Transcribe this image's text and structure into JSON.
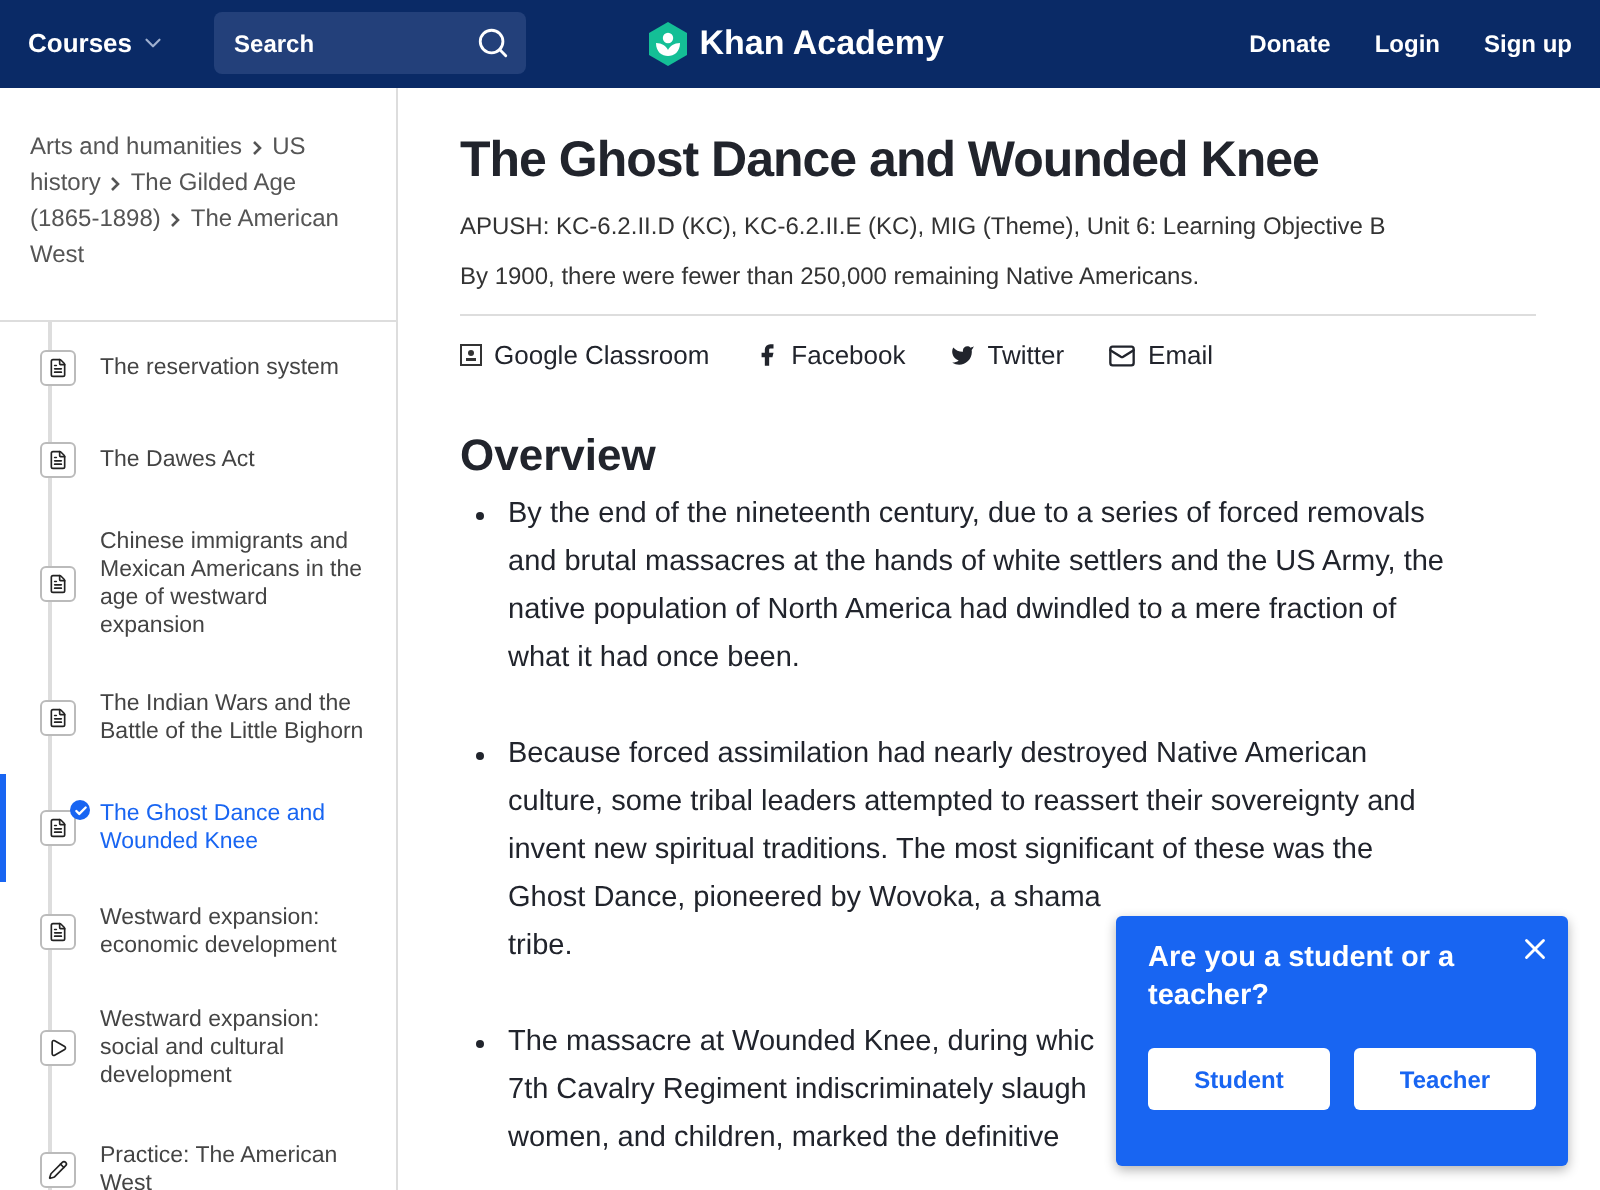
{
  "header": {
    "courses": "Courses",
    "search": {
      "placeholder": "Search"
    },
    "logo": "Khan Academy",
    "links": [
      "Donate",
      "Login",
      "Sign up"
    ]
  },
  "breadcrumb": [
    {
      "parts": [
        "Arts and humanities"
      ]
    },
    {
      "parts": [
        "US",
        "history"
      ]
    },
    {
      "parts": [
        "The Gilded Age",
        "(1865-1898)"
      ]
    },
    {
      "parts": [
        "The American",
        "West"
      ]
    }
  ],
  "sidebar": {
    "items": [
      {
        "kind": "article",
        "label": "The reservation system",
        "selected": false
      },
      {
        "kind": "article",
        "label": "The Dawes Act",
        "selected": false
      },
      {
        "kind": "article",
        "label": "Chinese immigrants and Mexican Americans in the age of westward expansion",
        "selected": false
      },
      {
        "kind": "article",
        "label": "The Indian Wars and the Battle of the Little Bighorn",
        "selected": false
      },
      {
        "kind": "article",
        "label": "The Ghost Dance and Wounded Knee",
        "selected": true
      },
      {
        "kind": "article",
        "label": "Westward expansion: economic development",
        "selected": false
      },
      {
        "kind": "video",
        "label": "Westward expansion: social and cultural development",
        "selected": false
      },
      {
        "kind": "exercise",
        "label": "Practice: The American West",
        "selected": false
      }
    ]
  },
  "article": {
    "title": "The Ghost Dance and Wounded Knee",
    "standards": "APUSH: KC-6.2.II.D (KC), KC-6.2.II.E (KC), MIG (Theme), Unit 6: Learning Objective B",
    "summary": "By 1900, there were fewer than 250,000 remaining Native Americans.",
    "share": [
      {
        "kind": "classroom",
        "label": "Google Classroom"
      },
      {
        "kind": "facebook",
        "label": "Facebook"
      },
      {
        "kind": "twitter",
        "label": "Twitter"
      },
      {
        "kind": "email",
        "label": "Email"
      }
    ],
    "heading": "Overview",
    "bullets": [
      [
        "By the end of the nineteenth century, due to a series of forced removals",
        "and brutal massacres at the hands of white settlers and the US Army, the",
        "native population of North America had dwindled to a mere fraction of",
        "what it had once been."
      ],
      [
        "Because forced assimilation had nearly destroyed Native American",
        "culture, some tribal leaders attempted to reassert their sovereignty and",
        "invent new spiritual traditions. The most significant of these was the",
        "Ghost Dance, pioneered by Wovoka, a shama",
        "tribe."
      ],
      [
        "The massacre at Wounded Knee, during whic",
        "7th Cavalry Regiment indiscriminately slaugh",
        "women, and children, marked the definitive"
      ]
    ]
  },
  "popup": {
    "question": "Are you a student or a teacher?",
    "buttons": [
      "Student",
      "Teacher"
    ]
  }
}
